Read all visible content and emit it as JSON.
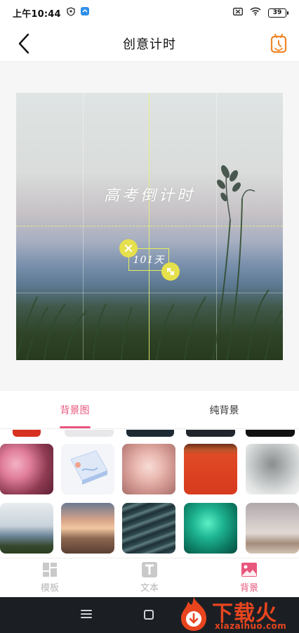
{
  "status_bar": {
    "time": "上午10:44",
    "battery": "39"
  },
  "header": {
    "title": "创意计时",
    "back_icon": "chevron-left-icon",
    "history_icon": "clock-tag-icon"
  },
  "preview": {
    "title_text": "高考倒计时",
    "days_text": "101天",
    "delete_icon": "close-icon",
    "resize_icon": "resize-icon",
    "guide_color": "#e8ef5a"
  },
  "tabs": [
    {
      "label": "背景图",
      "active": true
    },
    {
      "label": "纯背景",
      "active": false
    }
  ],
  "thumbnails": [
    {
      "name": "pink-blossom"
    },
    {
      "name": "isometric-card"
    },
    {
      "name": "pink-rose"
    },
    {
      "name": "red-wall"
    },
    {
      "name": "ink-mountain"
    },
    {
      "name": "grass-silhouette"
    },
    {
      "name": "sunset-beach"
    },
    {
      "name": "dark-waves"
    },
    {
      "name": "green-water-drops"
    },
    {
      "name": "cloudy-beach"
    }
  ],
  "bottom_nav": [
    {
      "label": "模板",
      "icon": "template-grid-icon",
      "active": false
    },
    {
      "label": "文本",
      "icon": "text-t-icon",
      "active": false
    },
    {
      "label": "背景",
      "icon": "image-icon",
      "active": true
    }
  ],
  "watermark": {
    "text": "下载火",
    "url": "xiazaihuo.com"
  },
  "colors": {
    "accent": "#e8577d",
    "inactive": "#b5b5b5",
    "watermark": "#e8451f"
  }
}
